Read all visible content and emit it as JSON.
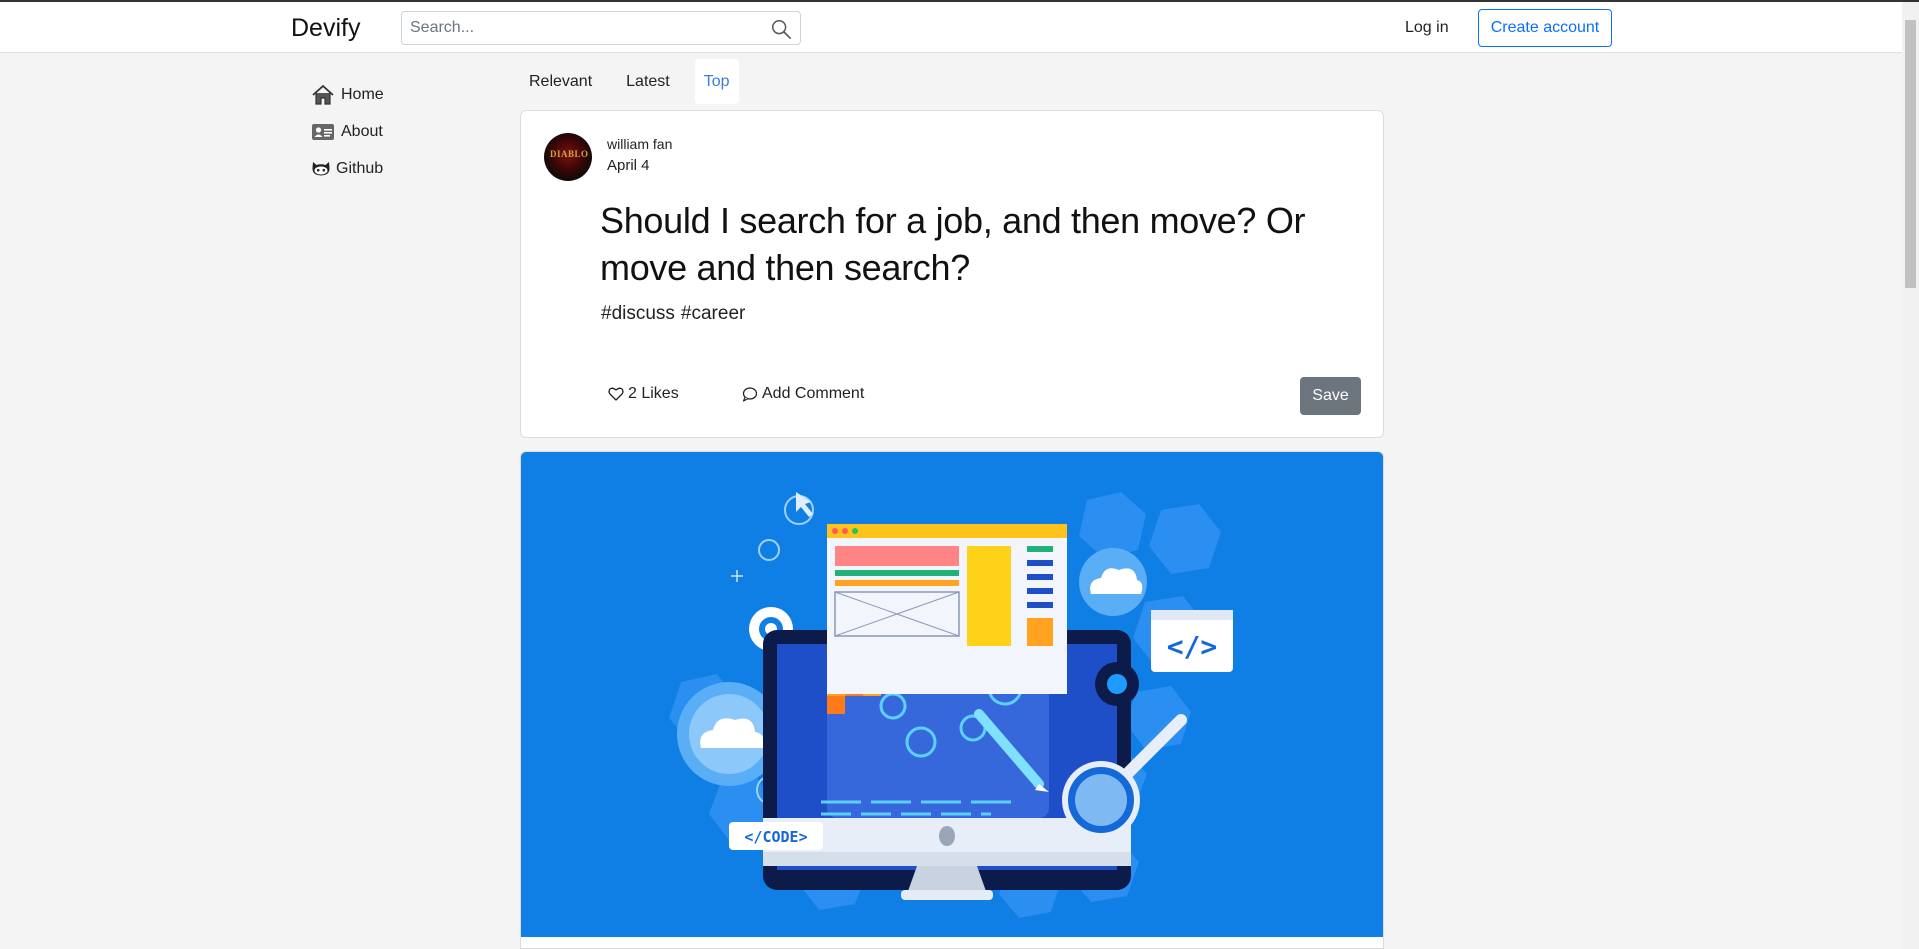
{
  "header": {
    "brand": "Devify",
    "search_placeholder": "Search...",
    "login_label": "Log in",
    "create_account_label": "Create account"
  },
  "sidebar": {
    "items": [
      {
        "label": "Home",
        "icon": "home-icon"
      },
      {
        "label": "About",
        "icon": "id-card-icon"
      },
      {
        "label": "Github",
        "icon": "github-icon"
      }
    ]
  },
  "tabs": [
    {
      "label": "Relevant",
      "active": false
    },
    {
      "label": "Latest",
      "active": false
    },
    {
      "label": "Top",
      "active": true
    }
  ],
  "post": {
    "author": "william fan",
    "date": "April 4",
    "title": "Should I search for a job, and then move? Or move and then search?",
    "tags": [
      "#discuss",
      "#career"
    ],
    "likes_label": "2 Likes",
    "comment_label": "Add Comment",
    "save_label": "Save",
    "avatar_text": "DIABLO"
  },
  "hero_image": {
    "code_badge": "</CODE>",
    "code_window": "</>"
  },
  "colors": {
    "accent": "#0d6efd",
    "active_tab": "#3b7dd8",
    "save_button": "#6c757d",
    "hero_background": "#0f7fe6"
  }
}
